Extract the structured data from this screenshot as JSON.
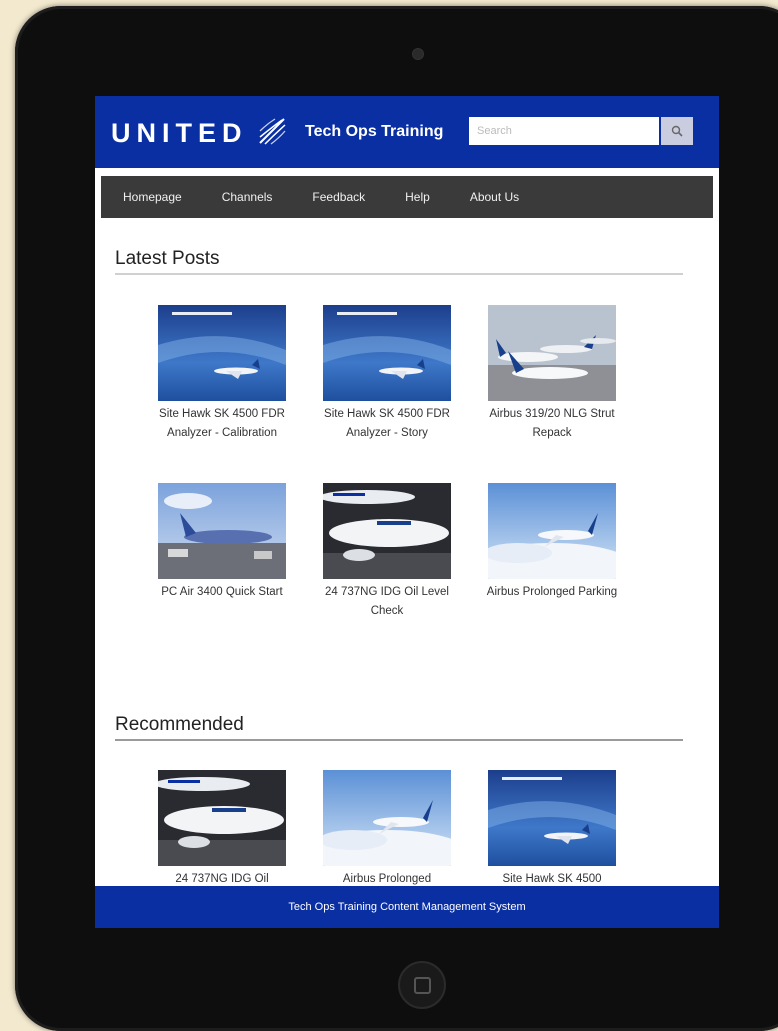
{
  "header": {
    "logo": "UNITED",
    "site_title": "Tech Ops Training",
    "search_placeholder": "Search"
  },
  "nav": {
    "items": [
      "Homepage",
      "Channels",
      "Feedback",
      "Help",
      "About Us"
    ]
  },
  "latest": {
    "title": "Latest Posts",
    "posts": [
      {
        "title": "Site Hawk SK 4500 FDR Analyzer - Calibration"
      },
      {
        "title": "Site Hawk SK 4500 FDR Analyzer - Story"
      },
      {
        "title": "Airbus 319/20 NLG Strut Repack"
      },
      {
        "title": "PC Air 3400 Quick Start"
      },
      {
        "title": "24 737NG IDG Oil Level Check"
      },
      {
        "title": "Airbus Prolonged Parking"
      }
    ]
  },
  "recommended": {
    "title": "Recommended",
    "posts": [
      {
        "title": "24 737NG IDG Oil"
      },
      {
        "title": "Airbus Prolonged"
      },
      {
        "title": "Site Hawk SK 4500"
      }
    ]
  },
  "footer": {
    "text": "Tech Ops Training Content Management System"
  },
  "icons": {
    "search": "search-icon",
    "logo_globe": "globe-icon"
  },
  "colors": {
    "brand_blue": "#0a2fa3",
    "nav_bg": "#3a3a3a",
    "rule_latest": "#d0d0d0",
    "rule_recommended": "#9a9a9a"
  }
}
